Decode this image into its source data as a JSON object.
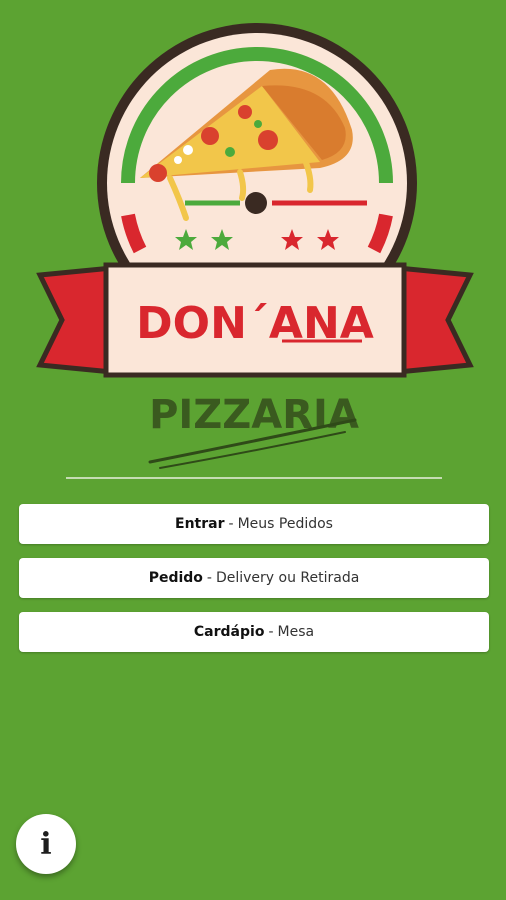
{
  "logo": {
    "brand_name": "DON´ANA",
    "subtitle": "PIZZARIA"
  },
  "menu": [
    {
      "bold": "Entrar",
      "separator": "-",
      "rest": "Meus Pedidos"
    },
    {
      "bold": "Pedido",
      "separator": "-",
      "rest": "Delivery ou Retirada"
    },
    {
      "bold": "Cardápio",
      "separator": "-",
      "rest": "Mesa"
    }
  ],
  "info_button": {
    "glyph": "i"
  },
  "colors": {
    "background": "#5ca332",
    "logo_green": "#4caa3c",
    "logo_red": "#d9272e",
    "logo_dark": "#3a2a22",
    "logo_cream": "#fbe6d8",
    "button": "#ffffff"
  },
  "icons": [
    "pizza-slice-icon",
    "star-icon",
    "info-icon"
  ]
}
